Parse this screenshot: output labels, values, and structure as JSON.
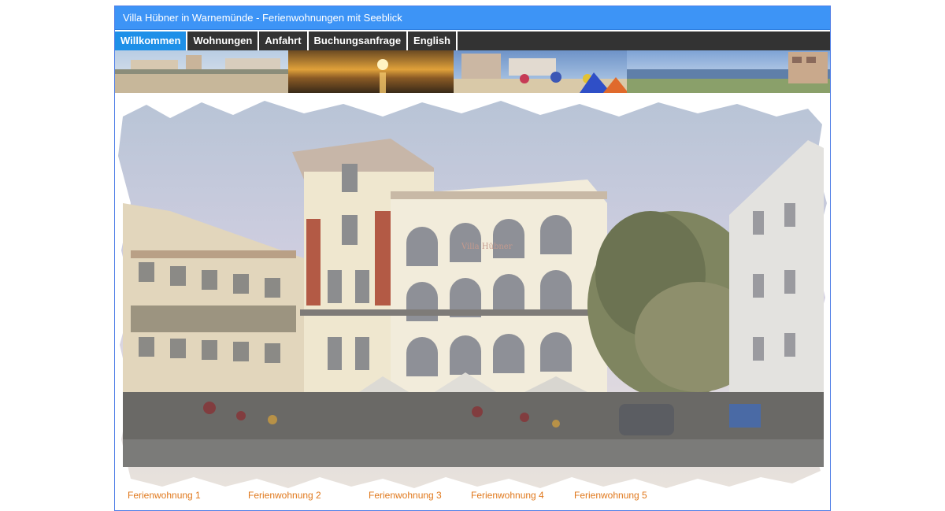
{
  "header": {
    "title": "Villa Hübner in Warnemünde - Ferienwohnungen mit Seeblick"
  },
  "nav": {
    "items": [
      {
        "label": "Willkommen",
        "active": true
      },
      {
        "label": "Wohnungen",
        "active": false
      },
      {
        "label": "Anfahrt",
        "active": false
      },
      {
        "label": "Buchungsanfrage",
        "active": false
      },
      {
        "label": "English",
        "active": false
      }
    ]
  },
  "apartments": {
    "links": [
      "Ferienwohnung 1",
      "Ferienwohnung 2",
      "Ferienwohnung 3",
      "Ferienwohnung 4",
      "Ferienwohnung 5"
    ]
  },
  "colors": {
    "title_bar": "#3d94f6",
    "nav_bar": "#333333",
    "nav_active": "#1e90e8",
    "link": "#e0781c"
  }
}
